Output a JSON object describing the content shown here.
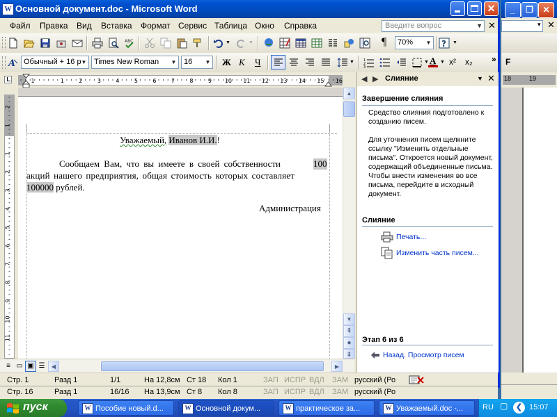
{
  "window": {
    "title": "Основной документ.doc - Microsoft Word",
    "title_icon": "W"
  },
  "menu": {
    "items": [
      "Файл",
      "Правка",
      "Вид",
      "Вставка",
      "Формат",
      "Сервис",
      "Таблица",
      "Окно",
      "Справка"
    ],
    "help_placeholder": "Введите вопрос"
  },
  "toolbar": {
    "zoom": "70%"
  },
  "format": {
    "style": "Обычный + 16 р",
    "font": "Times New Roman",
    "size": "16",
    "bold": "Ж",
    "italic": "К",
    "underline": "Ч",
    "superscript": "x²",
    "subscript": "x₂",
    "font_color_letter": "A"
  },
  "ruler_numbers": [
    "3",
    "2",
    "1",
    "1",
    "2",
    "3",
    "4",
    "5",
    "6",
    "7",
    "8",
    "9",
    "10",
    "11",
    "12",
    "13",
    "14",
    "15",
    "16",
    "17"
  ],
  "vruler_numbers": [
    "2",
    "1",
    "1",
    "2",
    "3",
    "4",
    "5",
    "6",
    "7",
    "8",
    "9",
    "10",
    "11",
    "12"
  ],
  "document": {
    "greeting_prefix": "Уважаемый,",
    "greeting_field": "Иванов И.И.",
    "greeting_suffix": "!",
    "line1_text": "Сообщаем Вам, что вы имеете в своей собственности",
    "line1_field": "100",
    "line2_text": "акций нашего предприятия, общая стоимость которых составляет",
    "line3_field": "100000",
    "line3_text": "рублей.",
    "signature": "Администрация"
  },
  "taskpane": {
    "title": "Слияние",
    "section1_title": "Завершение слияния",
    "para1": "Средство слияния подготовлено к созданию писем.",
    "para2": "Для уточнения писем щелкните ссылку \"Изменить отдельные письма\". Откроется новый документ, содержащий объединенные письма. Чтобы внести изменения во все письма, перейдите в исходный документ.",
    "section2_title": "Слияние",
    "link_print": "Печать...",
    "link_edit": "Изменить часть писем...",
    "step": "Этап 6 из 6",
    "back_link": "Назад. Просмотр писем"
  },
  "status": {
    "page": "Стр. 1",
    "section": "Разд 1",
    "pages": "1/1",
    "at": "На 12,8см",
    "line": "Ст 18",
    "col": "Кол 1",
    "rec": "ЗАП",
    "trk": "ИСПР",
    "ext": "ВДЛ",
    "ovr": "ЗАМ",
    "lang": "русский (Ро"
  },
  "bg_status": {
    "page": "Стр. 16",
    "section": "Разд 1",
    "pages": "16/16",
    "at": "На 13,9см",
    "line": "Ст 8",
    "col": "Кол 8",
    "rec": "ЗАП",
    "trk": "ИСПР",
    "ext": "ВДЛ",
    "ovr": "ЗАМ",
    "lang": "русский (Ро"
  },
  "bg_window": {
    "ruler": [
      "18",
      "19"
    ]
  },
  "taskbar": {
    "start": "пуск",
    "items": [
      "Пособие новый.d...",
      "Основной докум...",
      "практическое за...",
      "Уважаемый.doc -..."
    ],
    "lang": "RU",
    "clock": "15:07"
  },
  "colors": {
    "titlebar": "#0a5fd8",
    "border": "#0831d9",
    "link": "#0033cc",
    "start": "#2f8a2f"
  }
}
